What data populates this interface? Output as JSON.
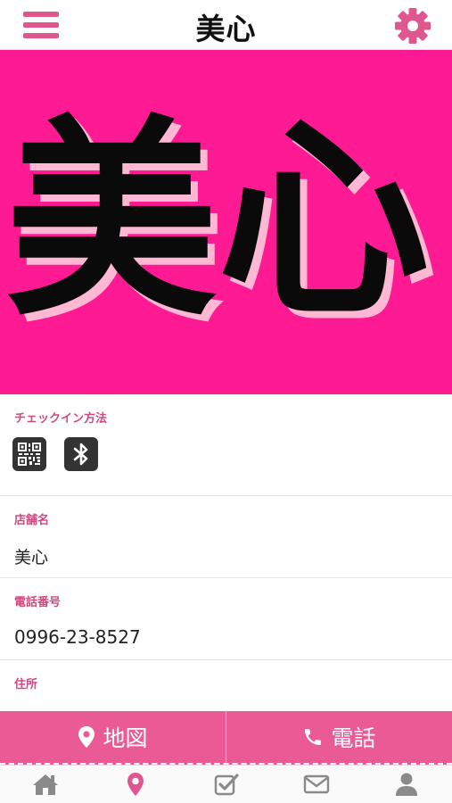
{
  "header": {
    "title": "美心"
  },
  "hero": {
    "text": "美心"
  },
  "checkin": {
    "label": "チェックイン方法"
  },
  "store": {
    "label": "店舗名",
    "value": "美心"
  },
  "phone": {
    "label": "電話番号",
    "value": "0996-23-8527"
  },
  "address": {
    "label": "住所",
    "value": ""
  },
  "actions": {
    "map_label": "地図",
    "call_label": "電話"
  },
  "tabs": [
    "home-icon",
    "location-pin-icon",
    "checklist-icon",
    "mail-icon",
    "user-icon"
  ],
  "colors": {
    "accent": "#e0578f",
    "hero_bg": "#fe1a93",
    "action_bar": "#ea5b96",
    "label": "#d0497f",
    "tab_active": "#e0578f",
    "tab_inactive": "#8a8a8a"
  }
}
